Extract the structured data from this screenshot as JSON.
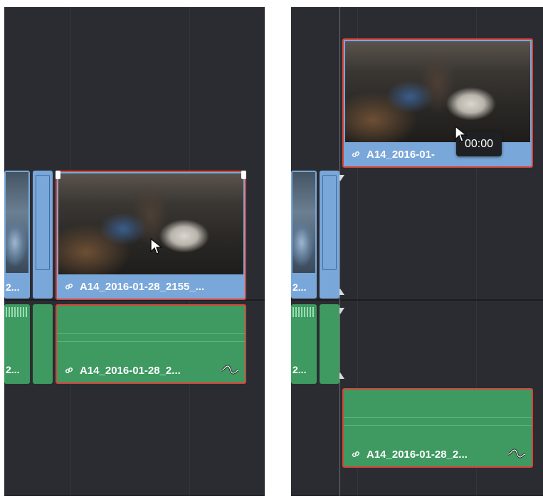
{
  "left_panel": {
    "video_clip_selected": {
      "label": "A14_2016-01-28_2155_..."
    },
    "audio_clip_selected": {
      "label": "A14_2016-01-28_2..."
    },
    "prev_video_clip": {
      "label": "2..."
    },
    "prev_audio_clip": {
      "label": "2..."
    }
  },
  "right_panel": {
    "video_clip_dragged": {
      "label": "A14_2016-01-"
    },
    "audio_clip_dragged": {
      "label": "A14_2016-01-28_2..."
    },
    "prev_video_clip": {
      "label": "2..."
    },
    "prev_audio_clip": {
      "label": "2..."
    },
    "tooltip": {
      "text": "00:00"
    }
  },
  "icons": [
    "link-icon",
    "waveform-icon",
    "pointer-cursor-icon",
    "playhead-marker-icon"
  ],
  "colors": {
    "background": "#2b2c31",
    "video_clip": "#7aa7d9",
    "audio_clip": "#3e9a61",
    "selection_border": "#d8443c",
    "tooltip_bg": "#1f2024"
  }
}
